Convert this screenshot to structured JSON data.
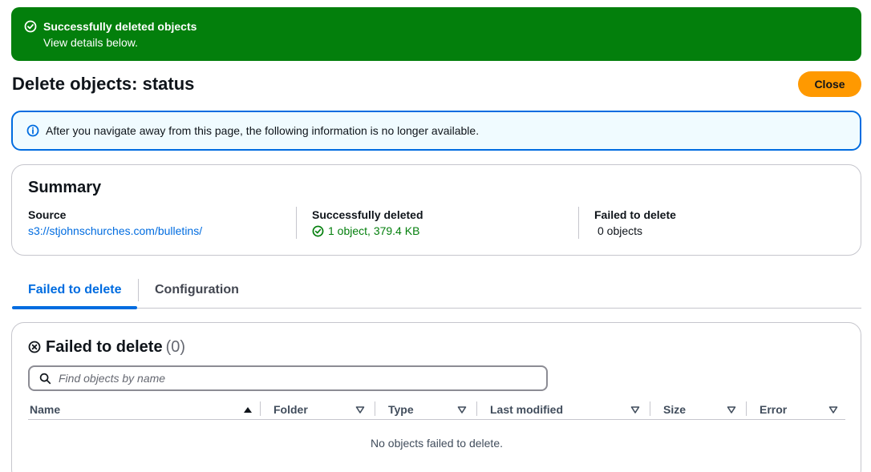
{
  "flash": {
    "title": "Successfully deleted objects",
    "description": "View details below.",
    "icon": "check-circle-icon",
    "color": "#037f0c"
  },
  "header": {
    "title": "Delete objects: status",
    "close_label": "Close",
    "accent": "#ff9900"
  },
  "info_alert": {
    "text": "After you navigate away from this page, the following information is no longer available.",
    "icon": "info-icon"
  },
  "summary": {
    "heading": "Summary",
    "source": {
      "label": "Source",
      "value": "s3://stjohnschurches.com/bulletins/"
    },
    "succeeded": {
      "label": "Successfully deleted",
      "value": "1 object, 379.4 KB"
    },
    "failed": {
      "label": "Failed to delete",
      "value": "0 objects"
    }
  },
  "tabs": [
    {
      "label": "Failed to delete",
      "active": true
    },
    {
      "label": "Configuration",
      "active": false
    }
  ],
  "failed_panel": {
    "title": "Failed to delete",
    "count": "(0)",
    "search_placeholder": "Find objects by name",
    "search_value": "",
    "columns": [
      "Name",
      "Folder",
      "Type",
      "Last modified",
      "Size",
      "Error"
    ],
    "empty_message": "No objects failed to delete."
  }
}
